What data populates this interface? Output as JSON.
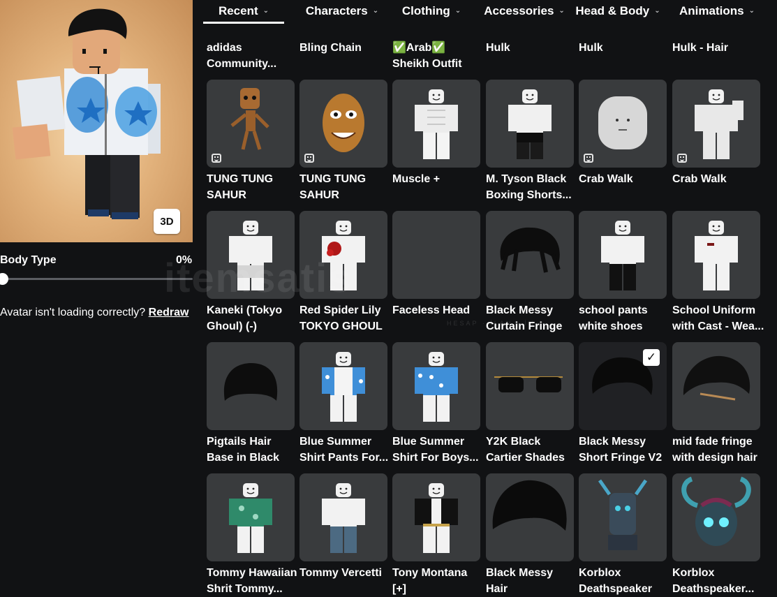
{
  "tabs": [
    {
      "label": "Recent",
      "active": true
    },
    {
      "label": "Characters"
    },
    {
      "label": "Clothing"
    },
    {
      "label": "Accessories"
    },
    {
      "label": "Head & Body"
    },
    {
      "label": "Animations"
    }
  ],
  "avatar": {
    "view_3d_label": "3D",
    "body_type_label": "Body Type",
    "body_type_value": "0%",
    "body_type_fraction": 0,
    "loading_prompt": "Avatar isn't loading correctly?",
    "redraw_label": "Redraw"
  },
  "items": [
    {
      "name": [
        "adidas",
        "Community..."
      ]
    },
    {
      "name": [
        "Bling Chain"
      ]
    },
    {
      "name": [
        "✅Arab✅",
        "Sheikh Outfit"
      ]
    },
    {
      "name": [
        "Hulk"
      ],
      "badge": true
    },
    {
      "name": [
        "Hulk"
      ],
      "badge": true
    },
    {
      "name": [
        "Hulk - Hair"
      ]
    },
    {
      "name": [
        "TUNG TUNG",
        "SAHUR"
      ],
      "badge": true
    },
    {
      "name": [
        "TUNG TUNG",
        "SAHUR"
      ],
      "badge": true
    },
    {
      "name": [
        "Muscle +"
      ]
    },
    {
      "name": [
        "M. Tyson Black",
        "Boxing Shorts..."
      ]
    },
    {
      "name": [
        "Crab Walk"
      ],
      "badge": true
    },
    {
      "name": [
        "Crab Walk"
      ],
      "badge": true
    },
    {
      "name": [
        "Kaneki (Tokyo",
        "Ghoul) (-)"
      ]
    },
    {
      "name": [
        "Red Spider Lily",
        "TOKYO GHOUL"
      ]
    },
    {
      "name": [
        "Faceless Head"
      ]
    },
    {
      "name": [
        "Black Messy",
        "Curtain Fringe"
      ]
    },
    {
      "name": [
        "school pants",
        "white shoes"
      ]
    },
    {
      "name": [
        "School Uniform",
        "with Cast - Wea..."
      ]
    },
    {
      "name": [
        "Pigtails Hair",
        "Base in Black"
      ]
    },
    {
      "name": [
        "Blue Summer",
        "Shirt Pants For..."
      ]
    },
    {
      "name": [
        "Blue Summer",
        "Shirt For Boys..."
      ]
    },
    {
      "name": [
        "Y2K Black",
        "Cartier Shades"
      ]
    },
    {
      "name": [
        "Black Messy",
        "Short Fringe V2"
      ],
      "selected": true
    },
    {
      "name": [
        "mid fade fringe",
        "with design hair"
      ]
    },
    {
      "name": [
        "Tommy Hawaiian",
        "Shrit Tommy..."
      ]
    },
    {
      "name": [
        "Tommy Vercetti"
      ]
    },
    {
      "name": [
        "Tony Montana",
        "[+]"
      ]
    },
    {
      "name": [
        "Black Messy",
        "Hair"
      ]
    },
    {
      "name": [
        "Korblox",
        "Deathspeaker"
      ]
    },
    {
      "name": [
        "Korblox",
        "Deathspeaker..."
      ]
    }
  ],
  "watermark": {
    "text": "itemsatis",
    "sub": "HESAP · İLAN · İN"
  },
  "colors": {
    "background": "#111214",
    "card": "#393b3d",
    "selected_card": "#202124",
    "text": "#ffffff"
  }
}
